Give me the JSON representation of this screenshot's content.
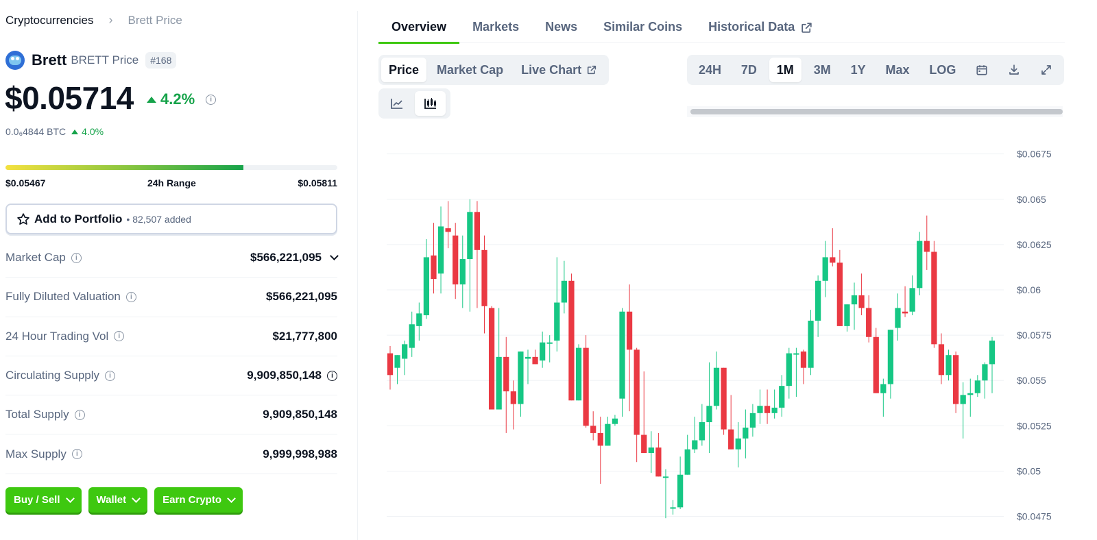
{
  "breadcrumb": {
    "root": "Cryptocurrencies",
    "sep": "›",
    "current": "Brett Price"
  },
  "coin": {
    "name": "Brett",
    "symbol": "BRETT Price",
    "rank": "#168"
  },
  "price": {
    "value": "$0.05714",
    "change": "4.2%",
    "btc": "0.0₆4844 BTC",
    "btc_change": "4.0%"
  },
  "range": {
    "low": "$0.05467",
    "label": "24h Range",
    "high": "$0.05811",
    "fill_fraction": 0.716
  },
  "portfolio": {
    "label": "Add to Portfolio",
    "count": "• 82,507 added"
  },
  "stats": [
    {
      "label": "Market Cap",
      "value": "$566,221,095"
    },
    {
      "label": "Fully Diluted Valuation",
      "value": "$566,221,095"
    },
    {
      "label": "24 Hour Trading Vol",
      "value": "$21,777,800"
    },
    {
      "label": "Circulating Supply",
      "value": "9,909,850,148"
    },
    {
      "label": "Total Supply",
      "value": "9,909,850,148"
    },
    {
      "label": "Max Supply",
      "value": "9,999,998,988"
    }
  ],
  "buttons": {
    "buy": "Buy / Sell",
    "wallet": "Wallet",
    "earn": "Earn Crypto"
  },
  "tabs": [
    "Overview",
    "Markets",
    "News",
    "Similar Coins",
    "Historical Data"
  ],
  "chart_types": [
    "Price",
    "Market Cap",
    "Live Chart"
  ],
  "ranges": [
    "24H",
    "7D",
    "1M",
    "3M",
    "1Y",
    "Max",
    "LOG"
  ],
  "colors": {
    "green": "#16a34a",
    "accent": "#3ec810",
    "candle_up": "#16c784",
    "candle_down": "#ea3943"
  },
  "chart_data": {
    "type": "candlestick",
    "ylim": [
      0.0465,
      0.069
    ],
    "yticks": [
      "$0.0475",
      "$0.05",
      "$0.0525",
      "$0.055",
      "$0.0575",
      "$0.06",
      "$0.0625",
      "$0.065",
      "$0.0675"
    ],
    "ytick_values": [
      0.0475,
      0.05,
      0.0525,
      0.055,
      0.0575,
      0.06,
      0.0625,
      0.065,
      0.0675
    ],
    "grid": true,
    "candles": [
      [
        0.0565,
        0.0569,
        0.0545,
        0.0553
      ],
      [
        0.0557,
        0.0564,
        0.0548,
        0.0564
      ],
      [
        0.0562,
        0.0572,
        0.0553,
        0.057
      ],
      [
        0.0568,
        0.0588,
        0.0563,
        0.0581
      ],
      [
        0.058,
        0.0593,
        0.0572,
        0.0587
      ],
      [
        0.0586,
        0.0628,
        0.0584,
        0.0618
      ],
      [
        0.0619,
        0.0637,
        0.0598,
        0.0606
      ],
      [
        0.0609,
        0.0646,
        0.0598,
        0.0635
      ],
      [
        0.0634,
        0.0649,
        0.0623,
        0.0632
      ],
      [
        0.063,
        0.0637,
        0.0595,
        0.0603
      ],
      [
        0.0603,
        0.063,
        0.059,
        0.0617
      ],
      [
        0.0617,
        0.065,
        0.0588,
        0.0643
      ],
      [
        0.0643,
        0.0649,
        0.059,
        0.0622
      ],
      [
        0.0622,
        0.063,
        0.0576,
        0.0591
      ],
      [
        0.059,
        0.0591,
        0.0548,
        0.0534
      ],
      [
        0.0534,
        0.059,
        0.0538,
        0.0563
      ],
      [
        0.0563,
        0.0574,
        0.0521,
        0.0544
      ],
      [
        0.0544,
        0.055,
        0.0523,
        0.0537
      ],
      [
        0.0537,
        0.0564,
        0.053,
        0.0566
      ],
      [
        0.0562,
        0.0567,
        0.0548,
        0.0563
      ],
      [
        0.0563,
        0.0567,
        0.0559,
        0.0559
      ],
      [
        0.0561,
        0.0577,
        0.0557,
        0.0571
      ],
      [
        0.0571,
        0.0575,
        0.056,
        0.0571
      ],
      [
        0.0572,
        0.0618,
        0.0566,
        0.0593
      ],
      [
        0.0593,
        0.0616,
        0.0587,
        0.0605
      ],
      [
        0.0605,
        0.0609,
        0.0562,
        0.0539
      ],
      [
        0.0539,
        0.057,
        0.054,
        0.0568
      ],
      [
        0.0568,
        0.0575,
        0.0524,
        0.0525
      ],
      [
        0.0525,
        0.0533,
        0.0517,
        0.0521
      ],
      [
        0.0521,
        0.053,
        0.0493,
        0.0514
      ],
      [
        0.0514,
        0.053,
        0.0514,
        0.0526
      ],
      [
        0.0526,
        0.0531,
        0.0525,
        0.0529
      ],
      [
        0.054,
        0.059,
        0.053,
        0.0588
      ],
      [
        0.0588,
        0.0603,
        0.0533,
        0.0567
      ],
      [
        0.0567,
        0.0568,
        0.0505,
        0.052
      ],
      [
        0.052,
        0.0555,
        0.0512,
        0.051
      ],
      [
        0.051,
        0.0522,
        0.0499,
        0.0513
      ],
      [
        0.0513,
        0.0521,
        0.0498,
        0.0497
      ],
      [
        0.0497,
        0.0501,
        0.0474,
        0.0497
      ],
      [
        0.048,
        0.0484,
        0.0476,
        0.048
      ],
      [
        0.048,
        0.0508,
        0.0479,
        0.0498
      ],
      [
        0.0498,
        0.052,
        0.0498,
        0.0512
      ],
      [
        0.0512,
        0.053,
        0.051,
        0.0517
      ],
      [
        0.0517,
        0.0537,
        0.0514,
        0.0527
      ],
      [
        0.0527,
        0.056,
        0.051,
        0.0536
      ],
      [
        0.0536,
        0.0566,
        0.0534,
        0.0557
      ],
      [
        0.0557,
        0.0557,
        0.052,
        0.0523
      ],
      [
        0.0523,
        0.0542,
        0.0512,
        0.0512
      ],
      [
        0.0512,
        0.0527,
        0.0502,
        0.0518
      ],
      [
        0.0518,
        0.0534,
        0.0507,
        0.0524
      ],
      [
        0.0524,
        0.0537,
        0.0519,
        0.0532
      ],
      [
        0.0532,
        0.0545,
        0.0526,
        0.0536
      ],
      [
        0.0536,
        0.0545,
        0.0526,
        0.0532
      ],
      [
        0.0532,
        0.0545,
        0.0529,
        0.0535
      ],
      [
        0.0535,
        0.0553,
        0.053,
        0.0547
      ],
      [
        0.0547,
        0.0568,
        0.054,
        0.0565
      ],
      [
        0.0565,
        0.0568,
        0.0541,
        0.0565
      ],
      [
        0.0566,
        0.0567,
        0.0548,
        0.0557
      ],
      [
        0.0557,
        0.0589,
        0.0553,
        0.0583
      ],
      [
        0.0583,
        0.0608,
        0.0574,
        0.0605
      ],
      [
        0.0605,
        0.0627,
        0.0596,
        0.0618
      ],
      [
        0.0618,
        0.0634,
        0.0613,
        0.0615
      ],
      [
        0.0615,
        0.0622,
        0.059,
        0.058
      ],
      [
        0.058,
        0.059,
        0.0577,
        0.0592
      ],
      [
        0.0592,
        0.0604,
        0.0578,
        0.0597
      ],
      [
        0.0597,
        0.0609,
        0.0586,
        0.059
      ],
      [
        0.059,
        0.0597,
        0.0571,
        0.0574
      ],
      [
        0.0574,
        0.0579,
        0.0544,
        0.0543
      ],
      [
        0.0543,
        0.0551,
        0.053,
        0.0548
      ],
      [
        0.0548,
        0.0578,
        0.054,
        0.0578
      ],
      [
        0.0579,
        0.0598,
        0.0572,
        0.059
      ],
      [
        0.0588,
        0.0602,
        0.0585,
        0.0587
      ],
      [
        0.0588,
        0.0608,
        0.0586,
        0.0601
      ],
      [
        0.0601,
        0.0632,
        0.0597,
        0.0627
      ],
      [
        0.0627,
        0.0641,
        0.0611,
        0.0621
      ],
      [
        0.0621,
        0.0627,
        0.0568,
        0.057
      ],
      [
        0.057,
        0.0576,
        0.0548,
        0.0553
      ],
      [
        0.0553,
        0.0567,
        0.055,
        0.0564
      ],
      [
        0.0564,
        0.0566,
        0.0532,
        0.0537
      ],
      [
        0.0537,
        0.0549,
        0.0518,
        0.0542
      ],
      [
        0.0542,
        0.0551,
        0.053,
        0.0543
      ],
      [
        0.0543,
        0.0553,
        0.0541,
        0.055
      ],
      [
        0.055,
        0.056,
        0.054,
        0.0559
      ],
      [
        0.0559,
        0.0574,
        0.0543,
        0.0572
      ]
    ]
  }
}
